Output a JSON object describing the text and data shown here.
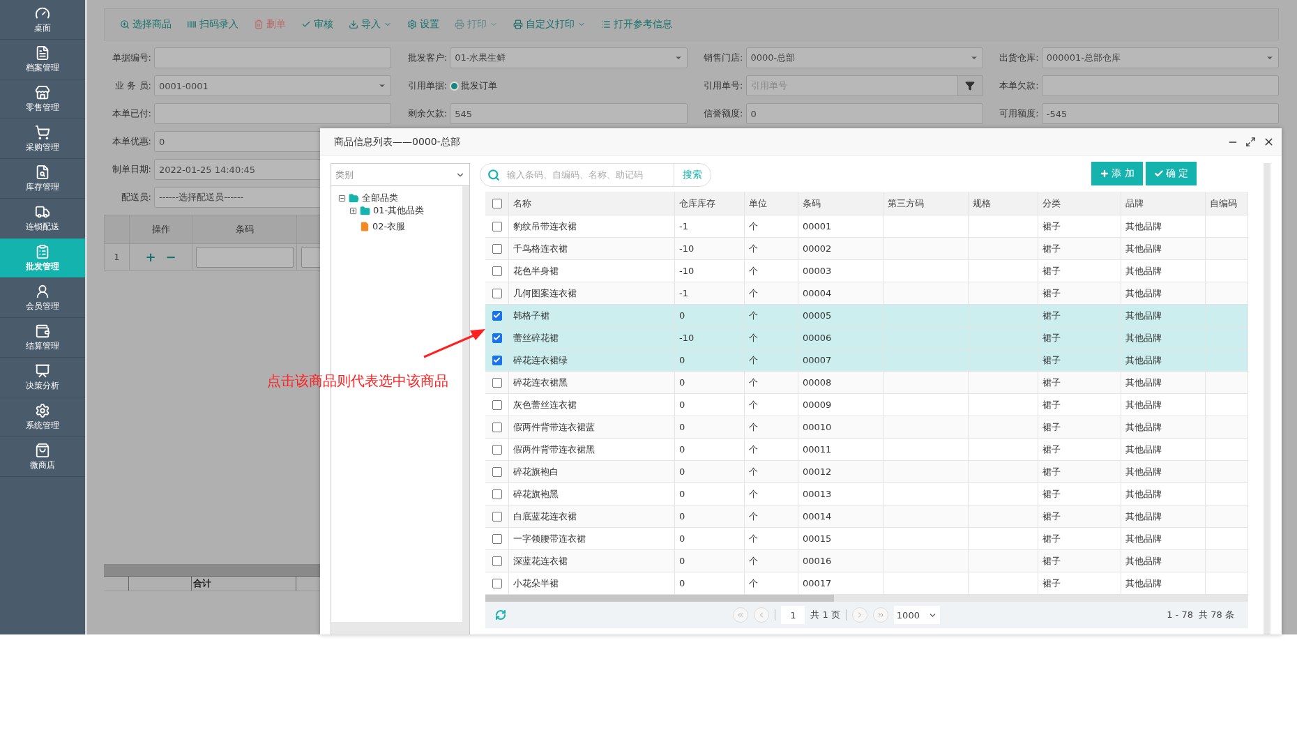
{
  "sidebar": {
    "items": [
      {
        "label": "桌面",
        "selected": false
      },
      {
        "label": "档案管理",
        "selected": false
      },
      {
        "label": "零售管理",
        "selected": false
      },
      {
        "label": "采购管理",
        "selected": false
      },
      {
        "label": "库存管理",
        "selected": false
      },
      {
        "label": "连锁配送",
        "selected": false
      },
      {
        "label": "批发管理",
        "selected": true
      },
      {
        "label": "会员管理",
        "selected": false
      },
      {
        "label": "结算管理",
        "selected": false
      },
      {
        "label": "决策分析",
        "selected": false
      },
      {
        "label": "系统管理",
        "selected": false
      },
      {
        "label": "微商店",
        "selected": false
      }
    ]
  },
  "toolbar": {
    "items": [
      {
        "label": "选择商品",
        "kind": "normal",
        "dropdown": false
      },
      {
        "label": "扫码录入",
        "kind": "normal",
        "dropdown": false
      },
      {
        "label": "删单",
        "kind": "danger",
        "dropdown": false
      },
      {
        "label": "审核",
        "kind": "normal",
        "dropdown": false
      },
      {
        "label": "导入",
        "kind": "normal",
        "dropdown": true
      },
      {
        "label": "设置",
        "kind": "normal",
        "dropdown": false
      },
      {
        "label": "打印",
        "kind": "muted",
        "dropdown": true
      },
      {
        "label": "自定义打印",
        "kind": "normal",
        "dropdown": true
      },
      {
        "label": "打开参考信息",
        "kind": "normal",
        "dropdown": false
      }
    ]
  },
  "form": {
    "rows": [
      [
        {
          "label": "单据编号:",
          "kind": "input"
        },
        {
          "label": "批发客户:",
          "kind": "select",
          "value": "01-水果生鲜"
        },
        {
          "label": "销售门店:",
          "kind": "select",
          "value": "0000-总部"
        },
        {
          "label": "出货仓库:",
          "kind": "select",
          "value": "000001-总部仓库"
        }
      ],
      [
        {
          "label": "业 务 员:",
          "kind": "select",
          "value": "0001-0001"
        },
        {
          "label": "引用单据:",
          "kind": "radio",
          "value": "批发订单",
          "selected": true
        },
        {
          "label": "引用单号:",
          "kind": "filter",
          "placeholder": "引用单号"
        },
        {
          "label": "本单欠款:",
          "kind": "input"
        }
      ],
      [
        {
          "label": "本单已付:",
          "kind": "input"
        },
        {
          "label": "剩余欠款:",
          "kind": "input",
          "value": "545"
        },
        {
          "label": "信誉额度:",
          "kind": "input",
          "value": "0"
        },
        {
          "label": "可用额度:",
          "kind": "input",
          "value": "-545"
        }
      ],
      [
        {
          "label": "本单优惠:",
          "kind": "input",
          "value": "0"
        }
      ],
      [
        {
          "label": "制单日期:",
          "kind": "input",
          "value": "2022-01-25 14:40:45"
        }
      ],
      [
        {
          "label": "配送员:",
          "kind": "input",
          "value": "------选择配送员------"
        }
      ]
    ]
  },
  "order_table": {
    "columns": [
      "操作",
      "条码"
    ],
    "rows": [
      {
        "number": "1",
        "add": "+",
        "remove": "−"
      }
    ],
    "footer": {
      "label": "合计"
    }
  },
  "dialog": {
    "title": "商品信息列表——0000-总部",
    "category_select": {
      "value": "类别"
    },
    "tree": [
      {
        "label": "全部品类",
        "kind": "folder",
        "expanded": true,
        "children": [
          {
            "label": "01-其他品类",
            "kind": "folder",
            "expanded": false
          },
          {
            "label": "02-衣服",
            "kind": "file"
          }
        ]
      }
    ],
    "search": {
      "placeholder": "输入条码、自编码、名称、助记码",
      "button": "搜索"
    },
    "buttons": [
      {
        "label": "添 加",
        "kind": "add"
      },
      {
        "label": "确 定",
        "kind": "confirm"
      }
    ],
    "table": {
      "all_selected": false,
      "columns": [
        "名称",
        "仓库库存",
        "单位",
        "条码",
        "第三方码",
        "规格",
        "分类",
        "品牌",
        "自编码"
      ],
      "rows": [
        {
          "selected": false,
          "cells": [
            "豹纹吊带连衣裙",
            "-1",
            "个",
            "00001",
            "",
            "",
            "裙子",
            "其他品牌",
            ""
          ]
        },
        {
          "selected": false,
          "cells": [
            "千鸟格连衣裙",
            "-10",
            "个",
            "00002",
            "",
            "",
            "裙子",
            "其他品牌",
            ""
          ]
        },
        {
          "selected": false,
          "cells": [
            "花色半身裙",
            "-10",
            "个",
            "00003",
            "",
            "",
            "裙子",
            "其他品牌",
            ""
          ]
        },
        {
          "selected": false,
          "cells": [
            "几何图案连衣裙",
            "-1",
            "个",
            "00004",
            "",
            "",
            "裙子",
            "其他品牌",
            ""
          ]
        },
        {
          "selected": true,
          "cells": [
            "韩格子裙",
            "0",
            "个",
            "00005",
            "",
            "",
            "裙子",
            "其他品牌",
            ""
          ]
        },
        {
          "selected": true,
          "cells": [
            "蕾丝碎花裙",
            "-10",
            "个",
            "00006",
            "",
            "",
            "裙子",
            "其他品牌",
            ""
          ]
        },
        {
          "selected": true,
          "cells": [
            "碎花连衣裙绿",
            "0",
            "个",
            "00007",
            "",
            "",
            "裙子",
            "其他品牌",
            ""
          ]
        },
        {
          "selected": false,
          "cells": [
            "碎花连衣裙黑",
            "0",
            "个",
            "00008",
            "",
            "",
            "裙子",
            "其他品牌",
            ""
          ]
        },
        {
          "selected": false,
          "cells": [
            "灰色蕾丝连衣裙",
            "0",
            "个",
            "00009",
            "",
            "",
            "裙子",
            "其他品牌",
            ""
          ]
        },
        {
          "selected": false,
          "cells": [
            "假两件背带连衣裙蓝",
            "0",
            "个",
            "00010",
            "",
            "",
            "裙子",
            "其他品牌",
            ""
          ]
        },
        {
          "selected": false,
          "cells": [
            "假两件背带连衣裙黑",
            "0",
            "个",
            "00011",
            "",
            "",
            "裙子",
            "其他品牌",
            ""
          ]
        },
        {
          "selected": false,
          "cells": [
            "碎花旗袍白",
            "0",
            "个",
            "00012",
            "",
            "",
            "裙子",
            "其他品牌",
            ""
          ]
        },
        {
          "selected": false,
          "cells": [
            "碎花旗袍黑",
            "0",
            "个",
            "00013",
            "",
            "",
            "裙子",
            "其他品牌",
            ""
          ]
        },
        {
          "selected": false,
          "cells": [
            "白底蓝花连衣裙",
            "0",
            "个",
            "00014",
            "",
            "",
            "裙子",
            "其他品牌",
            ""
          ]
        },
        {
          "selected": false,
          "cells": [
            "一字领腰带连衣裙",
            "0",
            "个",
            "00015",
            "",
            "",
            "裙子",
            "其他品牌",
            ""
          ]
        },
        {
          "selected": false,
          "cells": [
            "深蓝花连衣裙",
            "0",
            "个",
            "00016",
            "",
            "",
            "裙子",
            "其他品牌",
            ""
          ]
        },
        {
          "selected": false,
          "cells": [
            "小花朵半裙",
            "0",
            "个",
            "00017",
            "",
            "",
            "裙子",
            "其他品牌",
            ""
          ]
        }
      ]
    },
    "pager": {
      "page": "1",
      "pages": "共 1 页",
      "page_size": "1000",
      "summary": "1 - 78  共 78 条"
    }
  },
  "annotation": {
    "text": "点击该商品则代表选中该商品"
  }
}
